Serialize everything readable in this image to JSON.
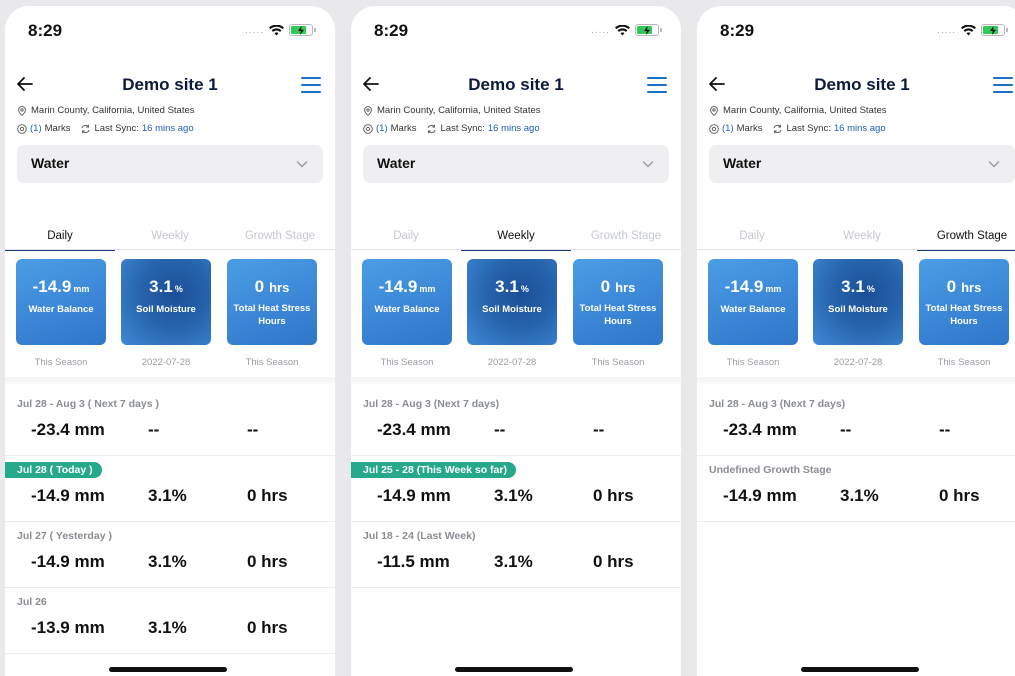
{
  "colors": {
    "accent": "#1a6fc7",
    "today_pill": "#26a98a",
    "title": "#0b1a3c"
  },
  "status_bar": {
    "time": "8:29",
    "dots": "....."
  },
  "icons": [
    "back-arrow-icon",
    "menu-icon",
    "location-pin-icon",
    "marks-icon",
    "sync-icon",
    "chevron-down-icon",
    "wifi-icon",
    "battery-icon",
    "location-arrow-icon"
  ],
  "screens": [
    {
      "title": "Demo site 1",
      "location": "Marin County, California, United States",
      "marks_count": "(1)",
      "marks_label": "Marks",
      "sync_label": "Last Sync:",
      "sync_value": "16 mins ago",
      "dropdown": "Water",
      "tabs": [
        "Daily",
        "Weekly",
        "Growth Stage"
      ],
      "active_tab": 0,
      "cards": [
        {
          "value": "-14.9",
          "unit": "mm",
          "label": "Water Balance",
          "sub": "This Season"
        },
        {
          "value": "3.1",
          "unit": "%",
          "label": "Soil Moisture",
          "sub": "2022-07-28"
        },
        {
          "value": "0",
          "unit": "hrs",
          "label": "Total Heat Stress Hours",
          "sub": "This Season"
        }
      ],
      "rows": [
        {
          "label": "Jul 28 - Aug 3 ( Next 7 days )",
          "values": [
            "-23.4 mm",
            "--",
            "--"
          ],
          "highlight": false
        },
        {
          "label": "Jul 28 ( Today )",
          "values": [
            "-14.9 mm",
            "3.1%",
            "0 hrs"
          ],
          "highlight": true
        },
        {
          "label": "Jul 27 ( Yesterday )",
          "values": [
            "-14.9 mm",
            "3.1%",
            "0 hrs"
          ],
          "highlight": false
        },
        {
          "label": "Jul 26",
          "values": [
            "-13.9 mm",
            "3.1%",
            "0 hrs"
          ],
          "highlight": false
        }
      ]
    },
    {
      "title": "Demo site 1",
      "location": "Marin County, California, United States",
      "marks_count": "(1)",
      "marks_label": "Marks",
      "sync_label": "Last Sync:",
      "sync_value": "16 mins ago",
      "dropdown": "Water",
      "tabs": [
        "Daily",
        "Weekly",
        "Growth Stage"
      ],
      "active_tab": 1,
      "cards": [
        {
          "value": "-14.9",
          "unit": "mm",
          "label": "Water Balance",
          "sub": "This Season"
        },
        {
          "value": "3.1",
          "unit": "%",
          "label": "Soil Moisture",
          "sub": "2022-07-28"
        },
        {
          "value": "0",
          "unit": "hrs",
          "label": "Total Heat Stress Hours",
          "sub": "This Season"
        }
      ],
      "rows": [
        {
          "label": "Jul 28 - Aug 3 (Next 7 days)",
          "values": [
            "-23.4 mm",
            "--",
            "--"
          ],
          "highlight": false
        },
        {
          "label": "Jul 25 - 28 (This Week so far)",
          "values": [
            "-14.9 mm",
            "3.1%",
            "0 hrs"
          ],
          "highlight": true
        },
        {
          "label": "Jul 18 - 24 (Last Week)",
          "values": [
            "-11.5 mm",
            "3.1%",
            "0 hrs"
          ],
          "highlight": false
        }
      ]
    },
    {
      "title": "Demo site 1",
      "location": "Marin County, California, United States",
      "marks_count": "(1)",
      "marks_label": "Marks",
      "sync_label": "Last Sync:",
      "sync_value": "16 mins ago",
      "dropdown": "Water",
      "tabs": [
        "Daily",
        "Weekly",
        "Growth Stage"
      ],
      "active_tab": 2,
      "cards": [
        {
          "value": "-14.9",
          "unit": "mm",
          "label": "Water Balance",
          "sub": "This Season"
        },
        {
          "value": "3.1",
          "unit": "%",
          "label": "Soil Moisture",
          "sub": "2022-07-28"
        },
        {
          "value": "0",
          "unit": "hrs",
          "label": "Total Heat Stress Hours",
          "sub": "This Season"
        }
      ],
      "rows": [
        {
          "label": "Jul 28 - Aug 3 (Next 7 days)",
          "values": [
            "-23.4 mm",
            "--",
            "--"
          ],
          "highlight": false
        },
        {
          "label": "Undefined Growth Stage",
          "values": [
            "-14.9 mm",
            "3.1%",
            "0 hrs"
          ],
          "highlight": false
        }
      ]
    }
  ]
}
